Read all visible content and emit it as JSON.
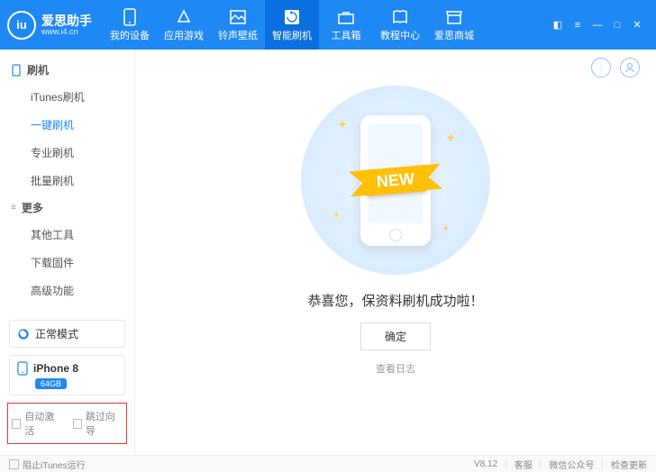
{
  "brand": {
    "logo_text": "iu",
    "title": "爱思助手",
    "subtitle": "www.i4.cn"
  },
  "nav": [
    {
      "label": "我的设备"
    },
    {
      "label": "应用游戏"
    },
    {
      "label": "铃声壁纸"
    },
    {
      "label": "智能刷机"
    },
    {
      "label": "工具箱"
    },
    {
      "label": "教程中心"
    },
    {
      "label": "爱思商城"
    }
  ],
  "sidebar": {
    "flash_title": "刷机",
    "flash_items": [
      "iTunes刷机",
      "一键刷机",
      "专业刷机",
      "批量刷机"
    ],
    "more_title": "更多",
    "more_items": [
      "其他工具",
      "下载固件",
      "高级功能"
    ]
  },
  "mode": {
    "label": "正常模式"
  },
  "device": {
    "name": "iPhone 8",
    "storage": "64GB"
  },
  "checks": {
    "auto_activate": "自动激活",
    "skip_guide": "跳过向导"
  },
  "main": {
    "ribbon": "NEW",
    "message": "恭喜您，保资料刷机成功啦！",
    "ok": "确定",
    "view_log": "查看日志"
  },
  "footer": {
    "prevent_itunes": "阻止iTunes运行",
    "version": "V8.12",
    "support": "客服",
    "wechat": "微信公众号",
    "update": "检查更新"
  }
}
